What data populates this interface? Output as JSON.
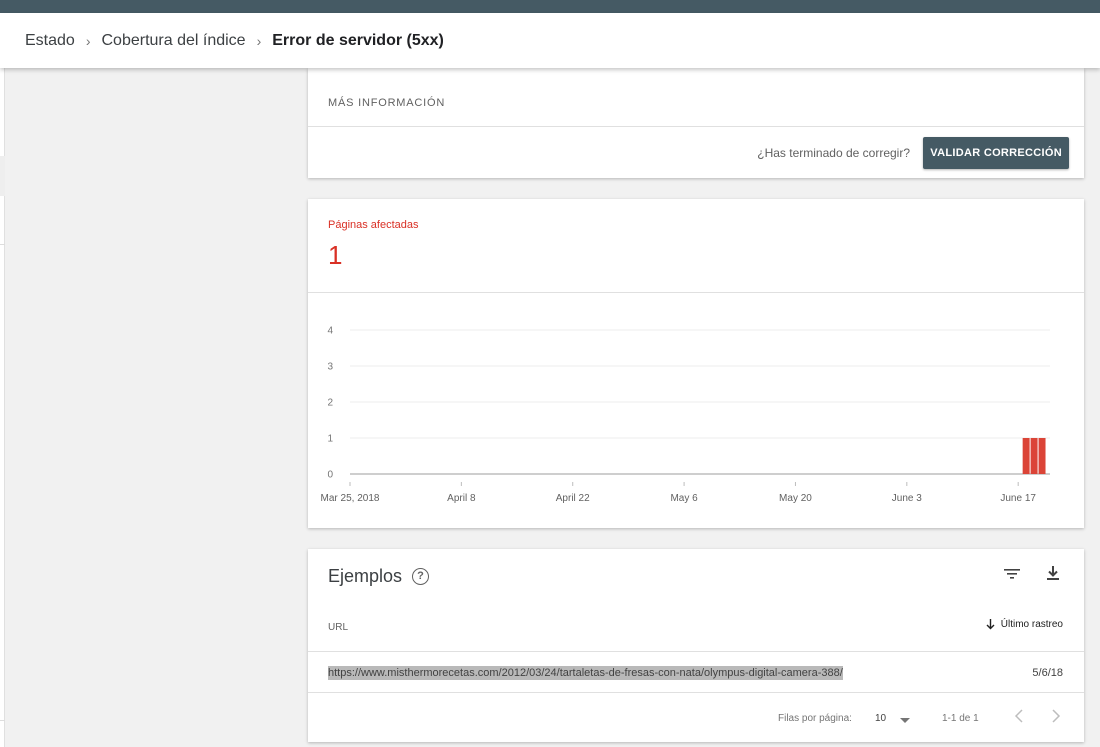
{
  "breadcrumb": {
    "items": [
      "Estado",
      "Cobertura del índice"
    ],
    "separator": "›",
    "current": "Error de servidor (5xx)"
  },
  "info_card": {
    "heading": "MÁS INFORMACIÓN",
    "question": "¿Has terminado de corregir?",
    "validate_label": "VALIDAR CORRECCIÓN"
  },
  "affected": {
    "label": "Páginas afectadas",
    "value": "1"
  },
  "chart_data": {
    "type": "bar",
    "y_ticks": [
      0,
      1,
      2,
      3,
      4
    ],
    "ylim": [
      0,
      4
    ],
    "x_tick_labels": [
      "Mar 25, 2018",
      "April 8",
      "April 22",
      "May 6",
      "May 20",
      "June 3",
      "June 17"
    ],
    "x_start": "2018-03-25",
    "x_end": "2018-06-21",
    "bars": [
      {
        "date": "2018-06-18",
        "value": 1
      },
      {
        "date": "2018-06-19",
        "value": 1
      },
      {
        "date": "2018-06-20",
        "value": 1
      }
    ],
    "bar_color": "#db4437",
    "grid": true
  },
  "examples": {
    "title": "Ejemplos",
    "help_icon": "help-circle-icon",
    "col_url": "URL",
    "col_date": "Último rastreo",
    "rows": [
      {
        "url": "https://www.misthermorecetas.com/2012/03/24/tartaletas-de-fresas-con-nata/olympus-digital-camera-388/",
        "date": "5/6/18"
      }
    ],
    "rows_per_page_label": "Filas por página:",
    "rows_per_page": "10",
    "range": "1-1 de 1"
  },
  "colors": {
    "accent": "#455a64",
    "error": "#d93025"
  }
}
